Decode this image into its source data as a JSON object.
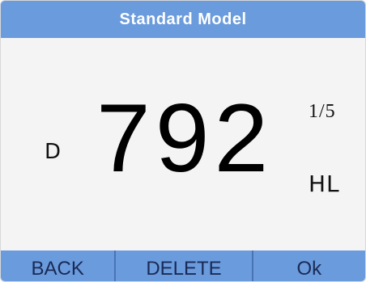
{
  "header": {
    "title": "Standard Model"
  },
  "measurement": {
    "direction": "D",
    "value": "792",
    "count": "1/5",
    "unit": "HL"
  },
  "softkeys": {
    "back": "BACK",
    "delete": "DELETE",
    "ok": "Ok"
  },
  "colors": {
    "accent": "#6a9bdd",
    "background": "#f4f4f4"
  }
}
